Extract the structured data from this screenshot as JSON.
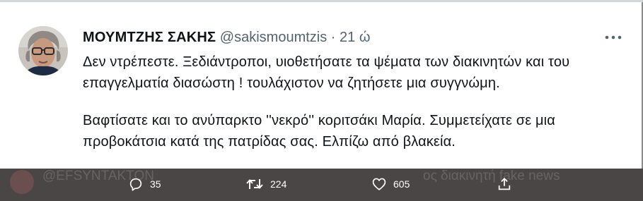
{
  "tweet": {
    "author_name": "ΜΟΥΜΤΖΗΣ ΣΑΚΗΣ",
    "handle": "@sakismoumtzis",
    "separator": "·",
    "time": "21 ώ",
    "paragraphs": [
      "Δεν ντρέπεστε. Ξεδιάντροποι, υιοθετήσατε τα ψέματα των διακινητών και του επαγγελματία διασώστη ! τουλάχιστον να ζητήσετε μια συγγνώμη.",
      "Βαφτίσατε και το ανύπαρκτο ''νεκρό'' κοριτσάκι Μαρία. Συμμετείχατε σε μια προβοκάτσια κατά της πατρίδας σας. Ελπίζω από βλακεία."
    ]
  },
  "actions": {
    "replies": "35",
    "retweets": "224",
    "likes": "605"
  },
  "background_ghost": {
    "left_text": "@EFSYNTAKTON",
    "right_text": "ος διακινητή fake news"
  },
  "icons": [
    "more-icon",
    "reply-icon",
    "retweet-icon",
    "like-icon",
    "share-icon"
  ],
  "colors": {
    "text": "#0f1419",
    "muted": "#536471",
    "action_bar": "#4b4646",
    "action_text": "#ffffff"
  }
}
